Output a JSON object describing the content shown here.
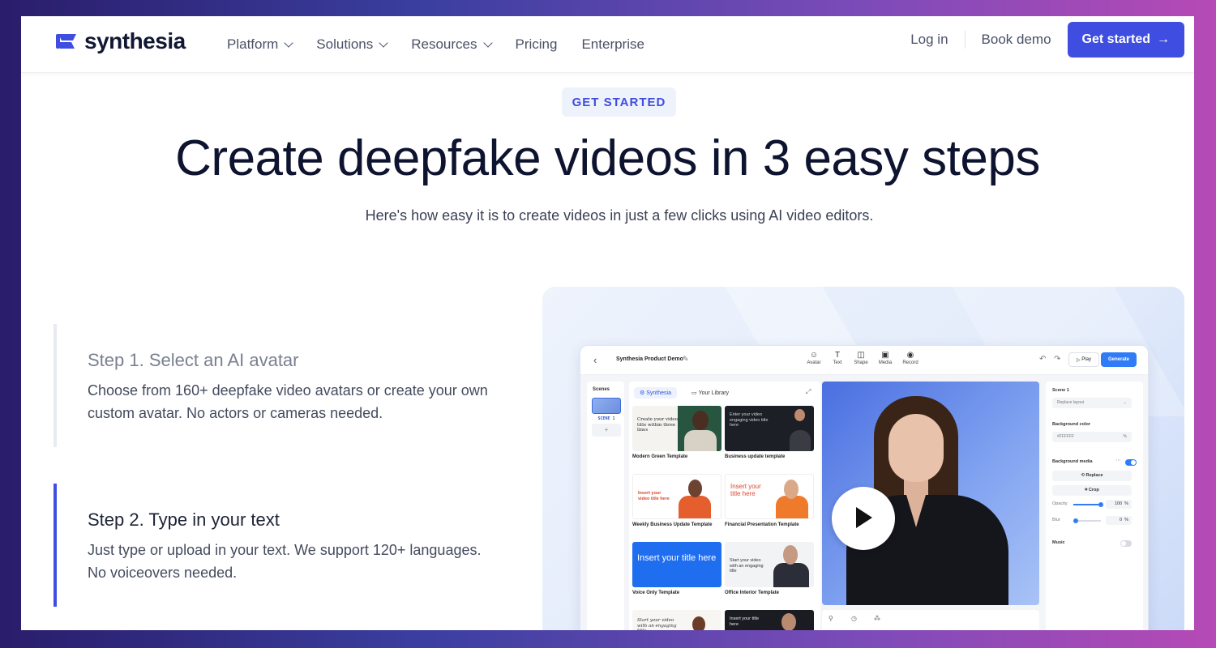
{
  "nav": {
    "logo_text": "synthesia",
    "menu": [
      {
        "label": "Platform",
        "has_dropdown": true
      },
      {
        "label": "Solutions",
        "has_dropdown": true
      },
      {
        "label": "Resources",
        "has_dropdown": true
      },
      {
        "label": "Pricing",
        "has_dropdown": false
      },
      {
        "label": "Enterprise",
        "has_dropdown": false
      }
    ],
    "login": "Log in",
    "book_demo": "Book demo",
    "cta": "Get started"
  },
  "hero": {
    "eyebrow": "GET STARTED",
    "title": "Create deepfake videos in 3 easy steps",
    "subtitle": "Here's how easy it is to create videos in just a few clicks using AI video editors."
  },
  "steps": [
    {
      "title": "Step 1. Select an AI avatar",
      "description": "Choose from 160+ deepfake video avatars or create your own custom avatar. No actors or cameras needed.",
      "active": false
    },
    {
      "title": "Step 2. Type in your text",
      "description": "Just type or upload in your text. We support 120+ languages. No voiceovers needed.",
      "active": true
    }
  ],
  "editor": {
    "title": "Synthesia Product Demo",
    "tools": [
      {
        "icon": "avatar-icon",
        "label": "Avatar"
      },
      {
        "icon": "text-icon",
        "label": "Text"
      },
      {
        "icon": "shape-icon",
        "label": "Shape"
      },
      {
        "icon": "media-icon",
        "label": "Media"
      },
      {
        "icon": "record-icon",
        "label": "Record"
      }
    ],
    "play": "Play",
    "generate": "Generate",
    "scenes_label": "Scenes",
    "scene_caption": "SCENE 1",
    "tabs": [
      "Synthesia",
      "Your Library"
    ],
    "templates": [
      {
        "caption": "Modern Green Template",
        "thumb_text": "Create your video title within three lines"
      },
      {
        "caption": "Business update template",
        "thumb_text": "Enter your video engaging video title here"
      },
      {
        "caption": "Weekly Business Update Template",
        "thumb_text": "Insert your video title here"
      },
      {
        "caption": "Financial Presentation Template",
        "thumb_text": "Insert your title here"
      },
      {
        "caption": "Voice Only Template",
        "thumb_text": "Insert your title here"
      },
      {
        "caption": "Office Interior Template",
        "thumb_text": "Start your video with an engaging title"
      },
      {
        "caption": "",
        "thumb_text": "Start your video with an engaging title"
      },
      {
        "caption": "",
        "thumb_text": "Insert your title here"
      }
    ],
    "props": {
      "scene": "Scene 1",
      "layout": "Replace layout",
      "bg_color_label": "Background color",
      "bg_color_value": "#FFFFFF",
      "bg_color_unit": "%",
      "bg_media_label": "Background media",
      "bg_media_on": true,
      "replace": "Replace",
      "crop": "Crop",
      "opacity_label": "Opacity",
      "opacity_value": "100",
      "opacity_pct": 100,
      "blur_label": "Blur",
      "blur_value": "0",
      "blur_pct": 0,
      "pct_unit": "%",
      "music_label": "Music",
      "music_on": false
    }
  },
  "colors": {
    "primary": "#3f4de0",
    "heading": "#0e1430",
    "generate": "#2f7cf6"
  }
}
